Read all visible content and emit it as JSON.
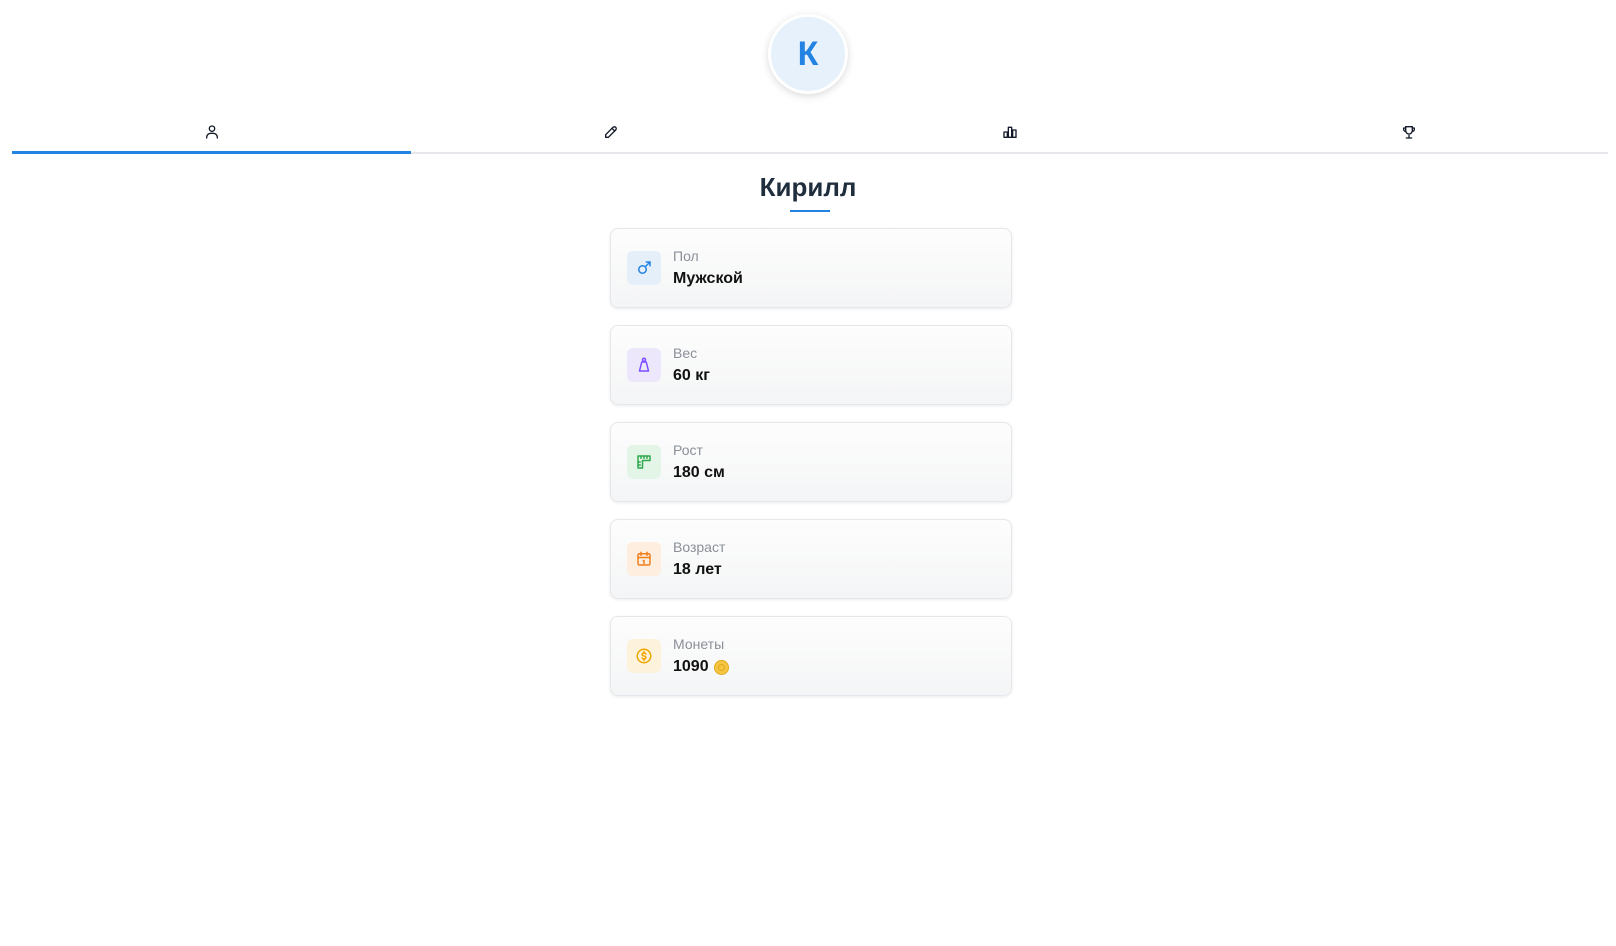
{
  "avatar": {
    "initial": "К",
    "color": "#2383e2",
    "background": "#e6f1fc"
  },
  "tabs": [
    {
      "icon": "user-icon",
      "active": true
    },
    {
      "icon": "pencil-icon",
      "active": false
    },
    {
      "icon": "leaderboard-icon",
      "active": false
    },
    {
      "icon": "trophy-icon",
      "active": false
    }
  ],
  "accent_color": "#2383e2",
  "profile": {
    "name": "Кирилл",
    "fields": [
      {
        "label": "Пол",
        "value": "Мужской",
        "icon": "male-icon",
        "icon_color": "#2383e2",
        "icon_bg": "#e4effa"
      },
      {
        "label": "Вес",
        "value": "60 кг",
        "icon": "weight-icon",
        "icon_color": "#7c4dff",
        "icon_bg": "#ede7fb"
      },
      {
        "label": "Рост",
        "value": "180 см",
        "icon": "ruler-icon",
        "icon_color": "#2fa84f",
        "icon_bg": "#e3f5e7"
      },
      {
        "label": "Возраст",
        "value": "18 лет",
        "icon": "calendar-icon",
        "icon_color": "#f07f1a",
        "icon_bg": "#fdeee0"
      },
      {
        "label": "Монеты",
        "value": "1090",
        "icon": "coin-icon",
        "icon_color": "#f0a500",
        "icon_bg": "#fdf3dc"
      }
    ]
  }
}
